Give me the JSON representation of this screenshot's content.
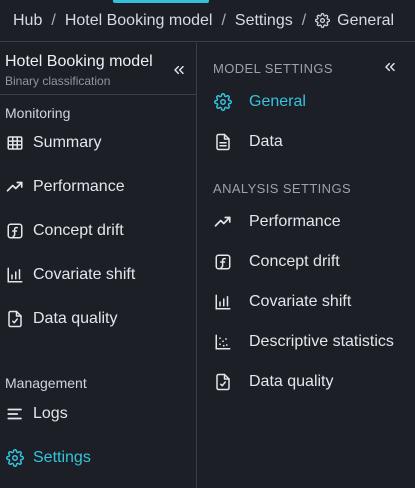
{
  "breadcrumb": {
    "items": [
      "Hub",
      "Hotel Booking model",
      "Settings",
      "General"
    ],
    "separator": "/"
  },
  "sidebar": {
    "title": "Hotel Booking model",
    "subtitle": "Binary classification",
    "sections": [
      {
        "label": "Monitoring",
        "items": [
          {
            "label": "Summary",
            "icon": "table-icon"
          },
          {
            "label": "Performance",
            "icon": "trend-icon"
          },
          {
            "label": "Concept drift",
            "icon": "function-icon"
          },
          {
            "label": "Covariate shift",
            "icon": "bar-chart-icon"
          },
          {
            "label": "Data quality",
            "icon": "file-check-icon"
          }
        ]
      },
      {
        "label": "Management",
        "items": [
          {
            "label": "Logs",
            "icon": "lines-icon"
          },
          {
            "label": "Settings",
            "icon": "gear-icon",
            "active": true
          }
        ]
      }
    ]
  },
  "panel": {
    "model_settings_heading": "MODEL SETTINGS",
    "model_items": [
      {
        "label": "General",
        "icon": "gear-icon",
        "active": true
      },
      {
        "label": "Data",
        "icon": "document-icon"
      }
    ],
    "analysis_settings_heading": "ANALYSIS SETTINGS",
    "analysis_items": [
      {
        "label": "Performance",
        "icon": "trend-icon"
      },
      {
        "label": "Concept drift",
        "icon": "function-icon"
      },
      {
        "label": "Covariate shift",
        "icon": "bar-chart-icon"
      },
      {
        "label": "Descriptive statistics",
        "icon": "scatter-icon"
      },
      {
        "label": "Data quality",
        "icon": "file-check-icon"
      }
    ]
  },
  "colors": {
    "background": "#1c1f26",
    "accent": "#35c3de",
    "border": "#3a3e48"
  }
}
